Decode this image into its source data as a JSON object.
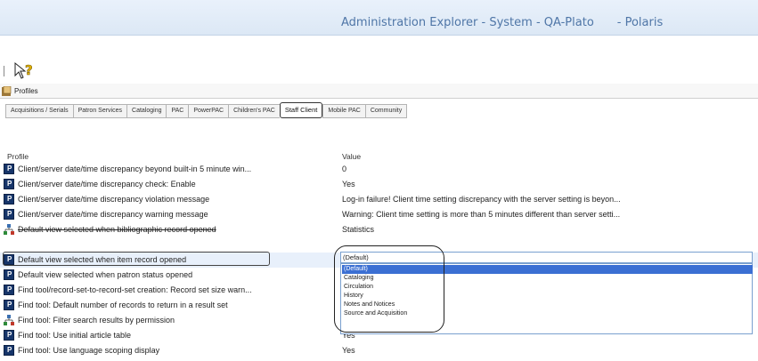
{
  "window": {
    "title": "Administration Explorer - System - QA-Plato",
    "product": "- Polaris"
  },
  "toolbar": {
    "help_icon": "help-pointer-icon"
  },
  "profiles_bar": {
    "label": "Profiles"
  },
  "tabs": [
    {
      "label": "Acquisitions / Serials"
    },
    {
      "label": "Patron Services"
    },
    {
      "label": "Cataloging"
    },
    {
      "label": "PAC"
    },
    {
      "label": "PowerPAC"
    },
    {
      "label": "Children's PAC"
    },
    {
      "label": "Staff Client",
      "active": true
    },
    {
      "label": "Mobile PAC"
    },
    {
      "label": "Community"
    }
  ],
  "columns": {
    "profile": "Profile",
    "value": "Value"
  },
  "rows": [
    {
      "name": "Client/server date/time discrepancy beyond built-in 5 minute win...",
      "value": "0",
      "icon": "p"
    },
    {
      "name": "Client/server date/time discrepancy check: Enable",
      "value": "Yes",
      "icon": "p"
    },
    {
      "name": "Client/server date/time discrepancy violation message",
      "value": "Log-in failure! Client time setting discrepancy with the server setting is beyon...",
      "icon": "p"
    },
    {
      "name": "Client/server date/time discrepancy warning message",
      "value": "Warning: Client time setting is more than 5 minutes different than server setti...",
      "icon": "p"
    },
    {
      "name": "Default view selected when bibliographic record opened",
      "value": "Statistics",
      "icon": "tree"
    },
    {
      "name": "Default view selected when item record opened",
      "value": "",
      "icon": "p",
      "selected": true
    },
    {
      "name": "Default view selected when patron status opened",
      "value": "",
      "icon": "p"
    },
    {
      "name": "Find tool/record-set-to-record-set creation: Record set size warn...",
      "value": "",
      "icon": "p"
    },
    {
      "name": "Find tool: Default number of records to return in a result set",
      "value": "",
      "icon": "p"
    },
    {
      "name": "Find tool: Filter search results by permission",
      "value": "",
      "icon": "tree"
    },
    {
      "name": "Find tool: Use initial article table",
      "value": "Yes",
      "icon": "p"
    },
    {
      "name": "Find tool: Use language scoping display",
      "value": "Yes",
      "icon": "p"
    }
  ],
  "dropdown": {
    "selected": "(Default)",
    "options": [
      "(Default)",
      "Cataloging",
      "Circulation",
      "History",
      "Notes and Notices",
      "Source and Acquisition"
    ]
  }
}
